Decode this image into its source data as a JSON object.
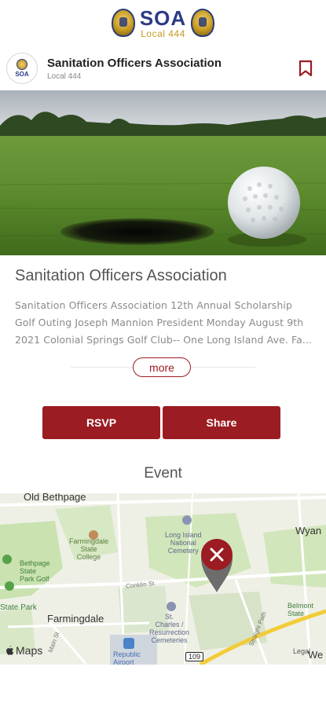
{
  "brand": {
    "logo_main": "SOA",
    "logo_sub": "Local 444"
  },
  "org": {
    "avatar_text": "SOA",
    "name": "Sanitation Officers Association",
    "subtitle": "Local 444"
  },
  "event": {
    "title": "Sanitation Officers Association",
    "description": "Sanitation Officers Association 12th Annual Scholarship Golf Outing Joseph Mannion President Monday August 9th 2021 Colonial Springs Golf Club-- One Long Island Ave. Fa...",
    "more_label": "more"
  },
  "actions": {
    "rsvp_label": "RSVP",
    "share_label": "Share"
  },
  "section": {
    "label": "Event"
  },
  "map": {
    "brand": "Maps",
    "labels": {
      "old_bethpage": "Old Bethpage",
      "farmingdale_state_college": "Farmingdale\nState\nCollege",
      "bethpage_state_park_golf": "Bethpage\nState\nPark Golf",
      "state_park": "State Park",
      "long_island_national_cemetery": "Long Island\nNational\nCemetery",
      "wyandanch": "Wyan",
      "conklin_st": "Conklin St",
      "farmingdale": "Farmingdale",
      "st_charles": "St.\nCharles /\nResurrection\nCemeteries",
      "straight_path": "Straight Path",
      "belmont_lake": "Belmont\nState",
      "republic_airport": "Republic\nAirport",
      "main_st": "Main St",
      "route": "109",
      "legal": "Legal",
      "we": "We"
    }
  },
  "colors": {
    "accent": "#9b1c22",
    "brand_blue": "#2c3a86",
    "brand_gold": "#c59a23"
  }
}
